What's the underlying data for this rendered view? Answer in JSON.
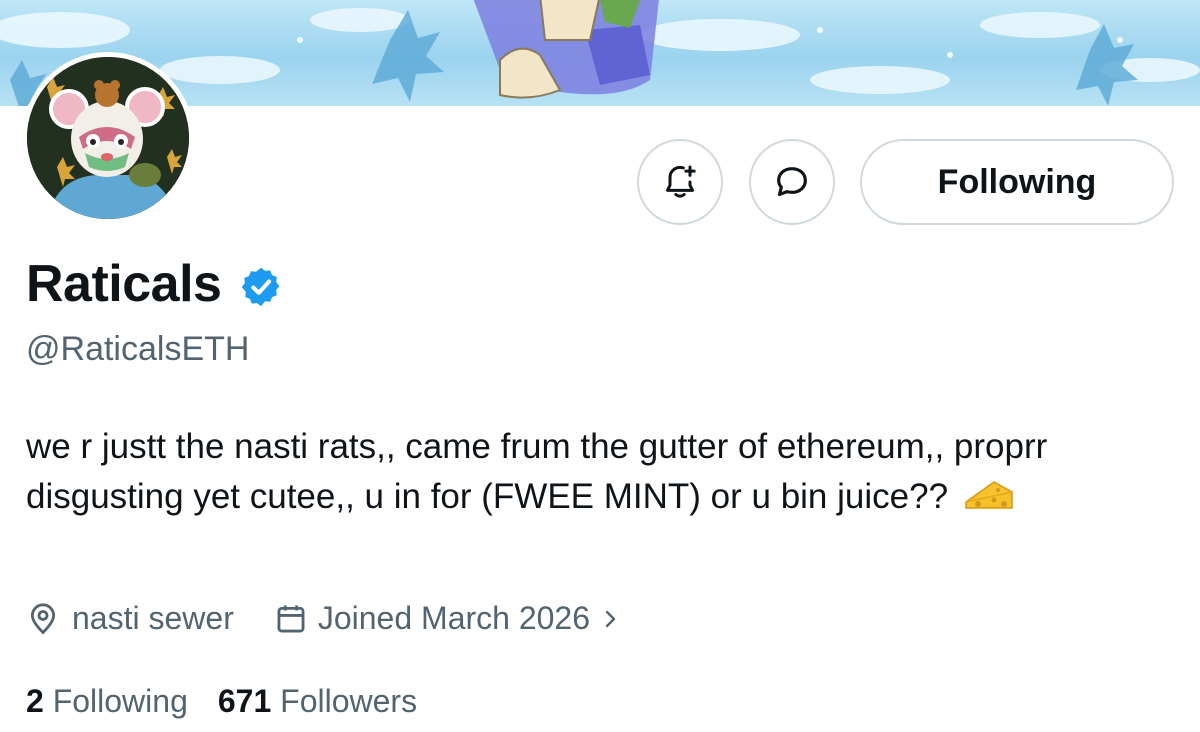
{
  "profile": {
    "display_name": "Raticals",
    "handle": "@RaticalsETH",
    "verified": true,
    "bio": "we r justt the nasti rats,, came frum the gutter of ethereum,, proprr disgusting yet cutee,, u in for (FWEE MINT) or u bin juice??",
    "bio_emoji": "cheese-emoji",
    "location": "nasti sewer",
    "joined": "Joined March 2026",
    "stats": {
      "following_count": "2",
      "following_label": "Following",
      "followers_count": "671",
      "followers_label": "Followers"
    }
  },
  "actions": {
    "notify_icon": "bell-plus-icon",
    "message_icon": "chat-bubble-icon",
    "follow_label": "Following"
  },
  "icons": {
    "location": "location-pin-icon",
    "calendar": "calendar-icon",
    "chevron": "chevron-right-icon",
    "verified": "verified-badge-icon"
  },
  "colors": {
    "verified_blue": "#1d9bf0",
    "secondary_text": "#536471",
    "border": "#cfd9de"
  }
}
